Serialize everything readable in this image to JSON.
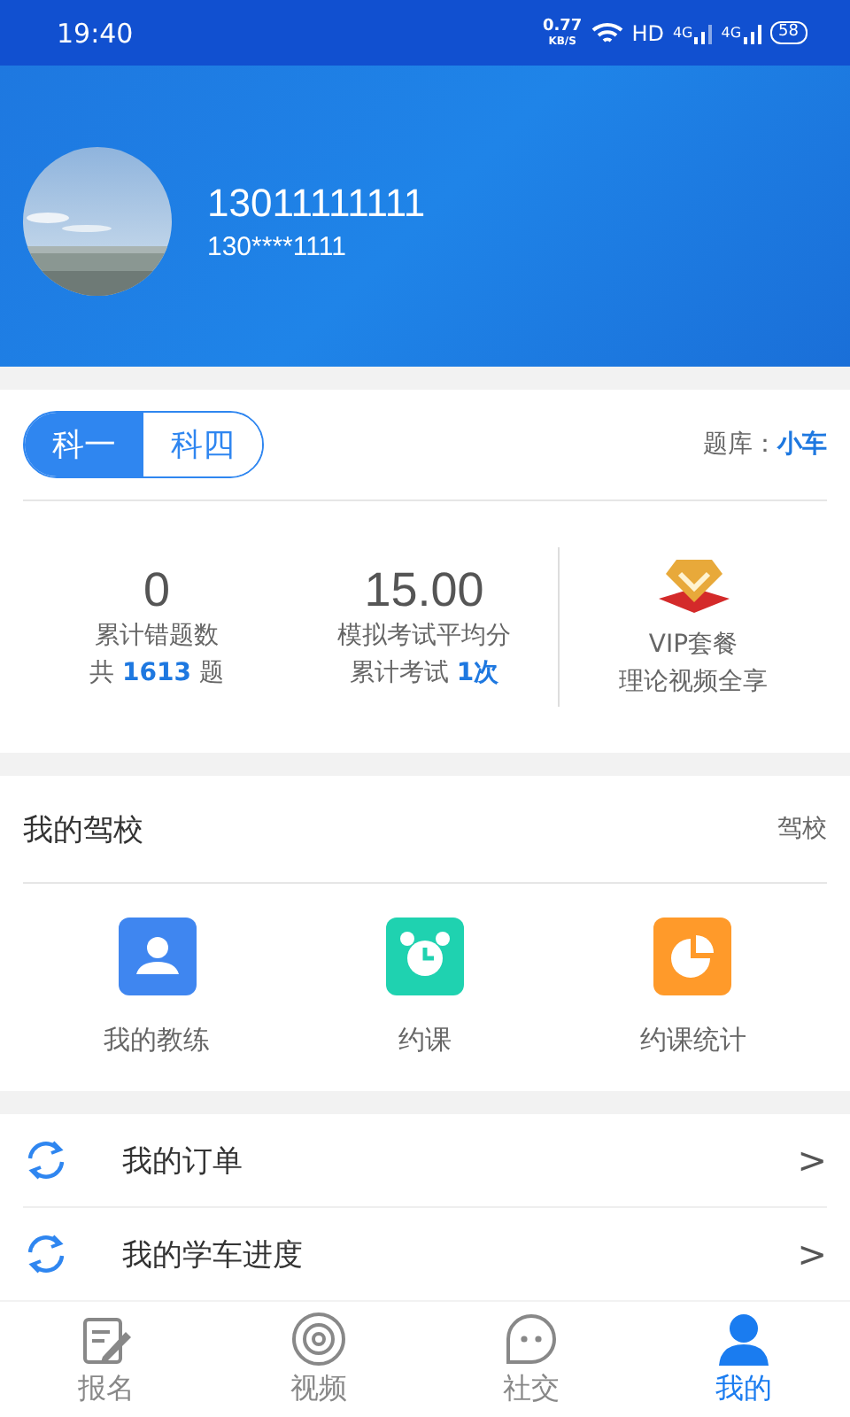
{
  "status_bar": {
    "time": "19:40",
    "speed": "0.77",
    "speed_unit": "KB/S",
    "hd": "HD",
    "signal_1": "4G",
    "signal_2": "4G",
    "battery": "58"
  },
  "profile": {
    "name": "13011111111",
    "phone": "130****1111"
  },
  "subjects": [
    {
      "label": "科一",
      "selected": true
    },
    {
      "label": "科四",
      "selected": false
    }
  ],
  "question_bank": {
    "label": "题库：",
    "value": "小车"
  },
  "stats": [
    {
      "value": "0",
      "label": "累计错题数",
      "note_prefix": "共 ",
      "note_value": "1613",
      "note_suffix": " 题"
    },
    {
      "value": "15.00",
      "label": "模拟考试平均分",
      "note_prefix": "累计考试 ",
      "note_value": "1次"
    }
  ],
  "vip": {
    "title": "VIP套餐",
    "subtitle": "理论视频全享"
  },
  "driving_school": {
    "title": "我的驾校",
    "link": "驾校",
    "items": [
      {
        "kind": "coach",
        "label": "我的教练"
      },
      {
        "kind": "booking",
        "label": "约课"
      },
      {
        "kind": "stats",
        "label": "约课统计"
      }
    ]
  },
  "menu": [
    {
      "label": "我的订单",
      "arrow": ">"
    },
    {
      "label": "我的学车进度",
      "arrow": ">"
    }
  ],
  "tabs": [
    {
      "kind": "signup",
      "label": "报名",
      "selected": false
    },
    {
      "kind": "video",
      "label": "视频",
      "selected": false
    },
    {
      "kind": "social",
      "label": "社交",
      "selected": false
    },
    {
      "kind": "me",
      "label": "我的",
      "selected": true
    }
  ]
}
